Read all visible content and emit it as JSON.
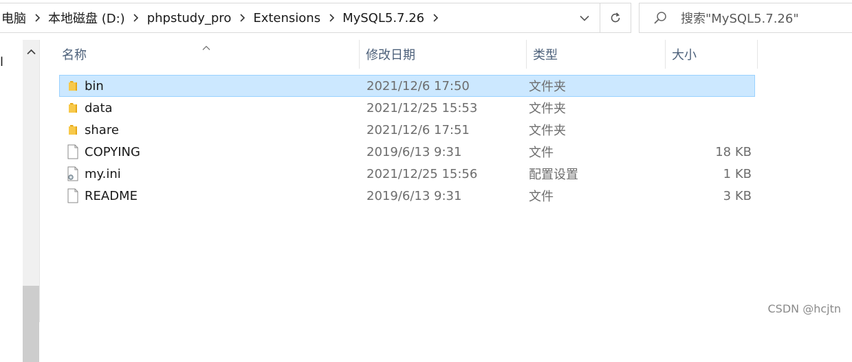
{
  "address_bar": {
    "crumbs": [
      "电脑",
      "本地磁盘 (D:)",
      "phpstudy_pro",
      "Extensions",
      "MySQL5.7.26"
    ]
  },
  "search": {
    "placeholder": "搜索\"MySQL5.7.26\""
  },
  "nav_pane": {
    "clipped_text": "l"
  },
  "columns": {
    "name": "名称",
    "modified": "修改日期",
    "type": "类型",
    "size": "大小"
  },
  "files": [
    {
      "name": "bin",
      "modified": "2021/12/6 17:50",
      "type": "文件夹",
      "size": "",
      "icon": "folder-icon",
      "selected": true
    },
    {
      "name": "data",
      "modified": "2021/12/25 15:53",
      "type": "文件夹",
      "size": "",
      "icon": "folder-icon",
      "selected": false
    },
    {
      "name": "share",
      "modified": "2021/12/6 17:51",
      "type": "文件夹",
      "size": "",
      "icon": "folder-icon",
      "selected": false
    },
    {
      "name": "COPYING",
      "modified": "2019/6/13 9:31",
      "type": "文件",
      "size": "18 KB",
      "icon": "file-icon",
      "selected": false
    },
    {
      "name": "my.ini",
      "modified": "2021/12/25 15:56",
      "type": "配置设置",
      "size": "1 KB",
      "icon": "config-file-icon",
      "selected": false
    },
    {
      "name": "README",
      "modified": "2019/6/13 9:31",
      "type": "文件",
      "size": "3 KB",
      "icon": "file-icon",
      "selected": false
    }
  ],
  "watermark": "CSDN @hcjtn",
  "colors": {
    "selection_bg": "#cce8ff",
    "selection_border": "#99d1ff",
    "header_text": "#4c607a",
    "folder_yellow": "#f8c94a"
  }
}
